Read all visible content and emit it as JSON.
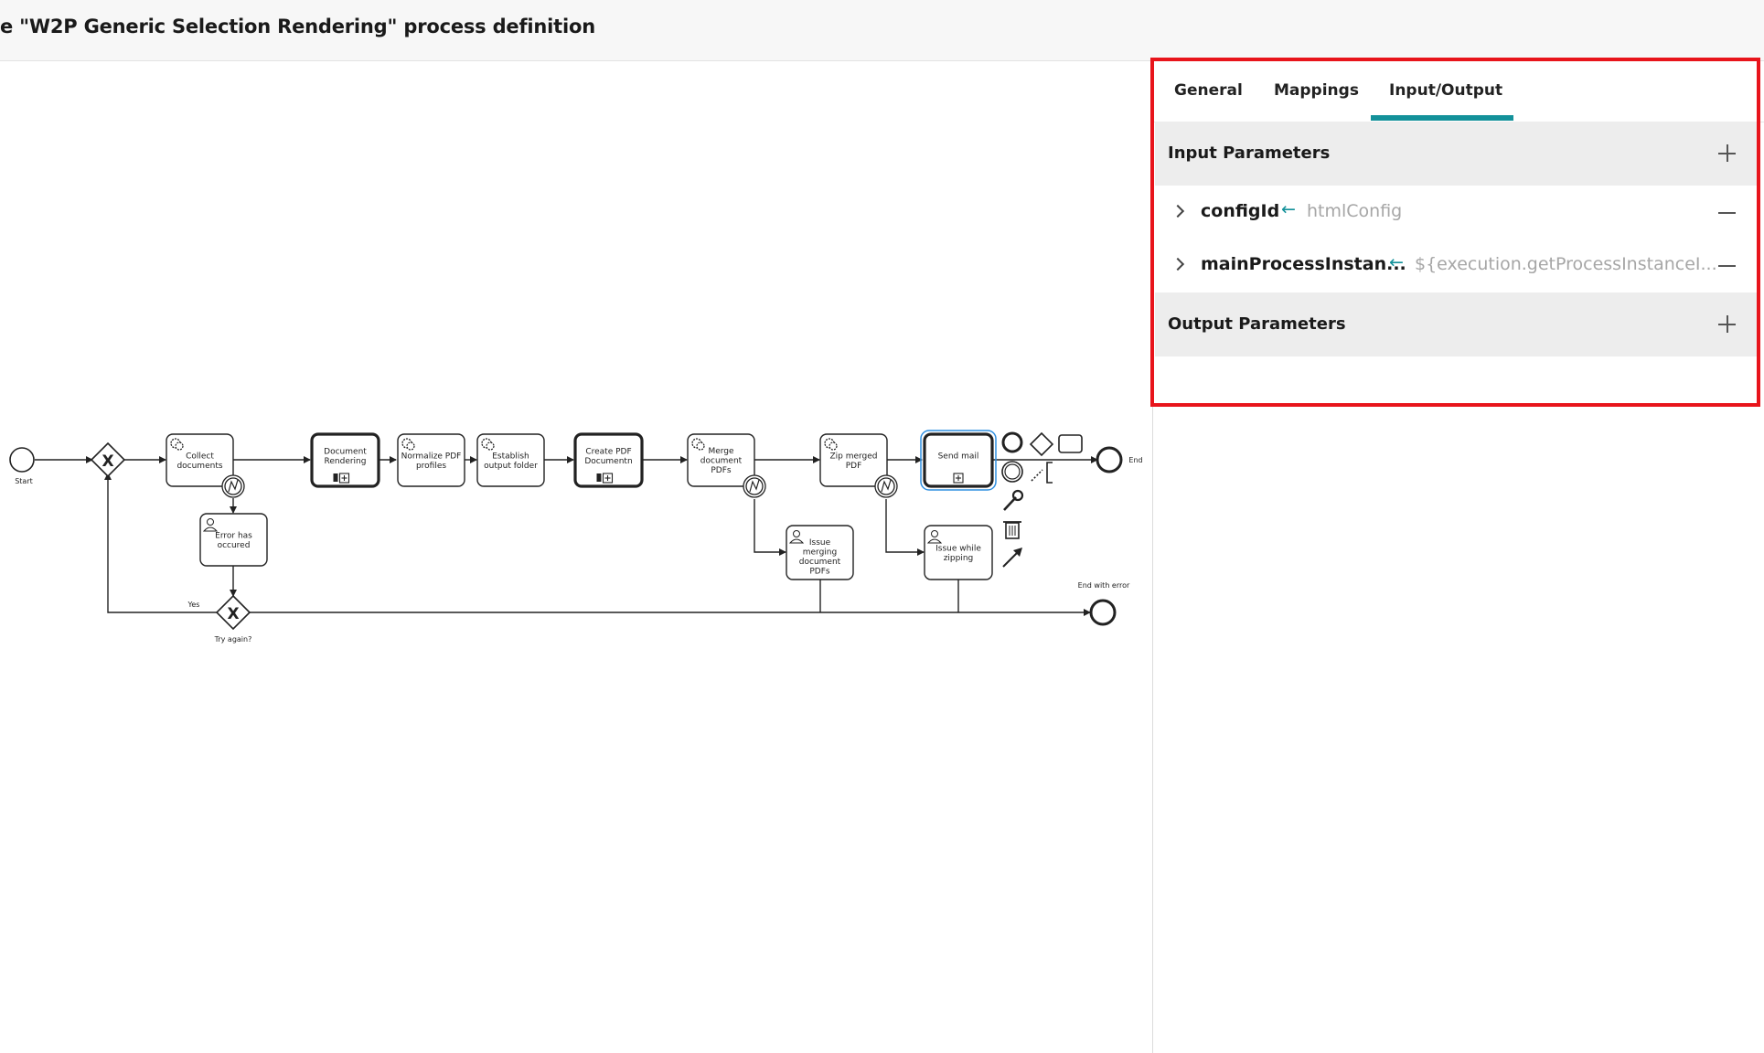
{
  "header": {
    "title": "e \"W2P Generic Selection Rendering\" process definition"
  },
  "tabs": [
    {
      "label": "General",
      "active": false
    },
    {
      "label": "Mappings",
      "active": false
    },
    {
      "label": "Input/Output",
      "active": true
    }
  ],
  "input_section": {
    "title": "Input Parameters",
    "params": [
      {
        "name": "configId",
        "value": "htmlConfig"
      },
      {
        "name": "mainProcessInstan...",
        "value": "${execution.getProcessInstanceI..."
      }
    ]
  },
  "output_section": {
    "title": "Output Parameters"
  },
  "diagram": {
    "events": {
      "start": "Start",
      "end": "End",
      "end_error": "End with error"
    },
    "tasks": {
      "collect": [
        "Collect",
        "documents"
      ],
      "render": [
        "Document",
        "Rendering"
      ],
      "normalize": [
        "Normalize PDF",
        "profiles"
      ],
      "establish": [
        "Establish",
        "output folder"
      ],
      "create_pdf": [
        "Create PDF",
        "Documentn"
      ],
      "merge": [
        "Merge",
        "document",
        "PDFs"
      ],
      "zip": [
        "Zip merged",
        "PDF"
      ],
      "send_mail": [
        "Send mail"
      ],
      "error": [
        "Error has",
        "occured"
      ],
      "issue_merge": [
        "Issue",
        "merging",
        "document",
        "PDFs"
      ],
      "issue_zip": [
        "Issue while",
        "zipping"
      ]
    },
    "gateway_labels": {
      "yes": "Yes",
      "try_again": "Try again?"
    }
  },
  "colors": {
    "accent": "#13919a",
    "highlight": "#e8141b",
    "selection": "#2f8fe0"
  }
}
